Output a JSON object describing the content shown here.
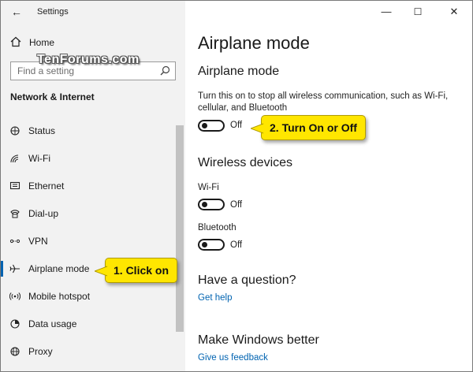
{
  "app_title": "Settings",
  "watermark": "TenForums.com",
  "sidebar": {
    "home_label": "Home",
    "search_placeholder": "Find a setting",
    "section_title": "Network & Internet",
    "items": [
      {
        "label": "Status",
        "icon": "status-globe-icon",
        "active": false
      },
      {
        "label": "Wi-Fi",
        "icon": "wifi-icon",
        "active": false
      },
      {
        "label": "Ethernet",
        "icon": "ethernet-icon",
        "active": false
      },
      {
        "label": "Dial-up",
        "icon": "dialup-phone-icon",
        "active": false
      },
      {
        "label": "VPN",
        "icon": "vpn-icon",
        "active": false
      },
      {
        "label": "Airplane mode",
        "icon": "airplane-icon",
        "active": true
      },
      {
        "label": "Mobile hotspot",
        "icon": "hotspot-icon",
        "active": false
      },
      {
        "label": "Data usage",
        "icon": "data-usage-icon",
        "active": false
      },
      {
        "label": "Proxy",
        "icon": "proxy-globe-icon",
        "active": false
      }
    ]
  },
  "window_controls": {
    "minimize": "—",
    "maximize": "☐",
    "close": "✕"
  },
  "main": {
    "page_title": "Airplane mode",
    "airplane_heading": "Airplane mode",
    "airplane_desc": "Turn this on to stop all wireless communication, such as Wi-Fi, cellular, and Bluetooth",
    "airplane_toggle": {
      "state": "Off",
      "on": false
    },
    "wireless_heading": "Wireless devices",
    "wifi_label": "Wi-Fi",
    "wifi_toggle": {
      "state": "Off",
      "on": false
    },
    "bluetooth_label": "Bluetooth",
    "bluetooth_toggle": {
      "state": "Off",
      "on": false
    },
    "question_heading": "Have a question?",
    "get_help": "Get help",
    "better_heading": "Make Windows better",
    "feedback": "Give us feedback"
  },
  "callouts": {
    "step1": "1. Click on",
    "step2": "2. Turn On or Off"
  },
  "colors": {
    "accent": "#0063b1",
    "callout": "#ffe600",
    "sidebar_bg": "#f2f2f2"
  }
}
